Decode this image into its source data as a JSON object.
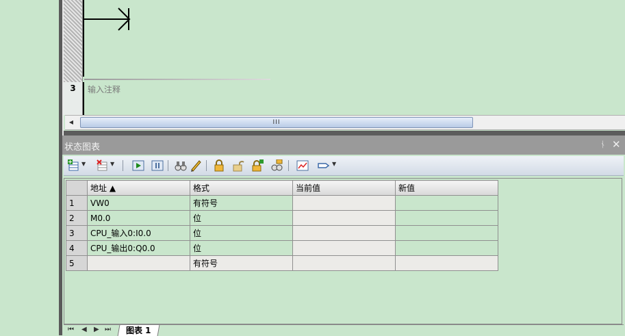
{
  "editor": {
    "network_number": "3",
    "comment_placeholder": "输入注释",
    "scroll_grip": "III"
  },
  "panel": {
    "title": "状态图表",
    "pin_glyph": "ᚾ",
    "close_glyph": "✕"
  },
  "toolbar": {
    "icons": [
      "add-row-icon",
      "delete-row-icon",
      "trend-run-icon",
      "trend-pause-icon",
      "binoculars-icon",
      "pencil-icon",
      "lock-icon",
      "unlock-icon",
      "force-lock-icon",
      "read-all-forced-icon",
      "trend-chart-icon",
      "tag-icon"
    ]
  },
  "table": {
    "headers": [
      "地址 ▲",
      "格式",
      "当前值",
      "新值"
    ],
    "rows": [
      {
        "num": "1",
        "address": "VW0",
        "format": "有符号",
        "current": "",
        "new": ""
      },
      {
        "num": "2",
        "address": "M0.0",
        "format": "位",
        "current": "",
        "new": ""
      },
      {
        "num": "3",
        "address": "CPU_输入0:I0.0",
        "format": "位",
        "current": "",
        "new": ""
      },
      {
        "num": "4",
        "address": "CPU_输出0:Q0.0",
        "format": "位",
        "current": "",
        "new": ""
      },
      {
        "num": "5",
        "address": "",
        "format": "有符号",
        "current": "",
        "new": ""
      }
    ]
  },
  "tabs": {
    "nav_first": "⏮",
    "nav_prev": "◀",
    "nav_next": "▶",
    "nav_last": "⏭",
    "sheet_label": "图表 1"
  },
  "colors": {
    "background": "#c9e6cc",
    "panel_title_bar": "#9a9a9a",
    "splitter": "#5c5c5c"
  }
}
